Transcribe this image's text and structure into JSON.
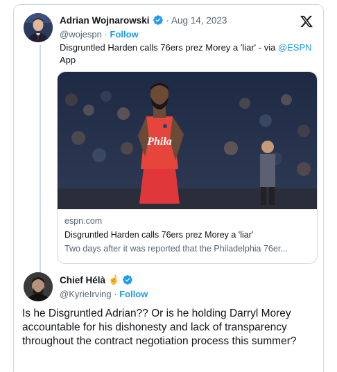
{
  "tweet1": {
    "display_name": "Adrian Wojnarowski",
    "date": "Aug 14, 2023",
    "handle": "@wojespn",
    "separator": "·",
    "follow_label": "Follow",
    "text_main": "Disgruntled Harden calls 76ers prez Morey a 'liar' - via ",
    "text_mention": "@ESPN",
    "text_tail": " App",
    "link_card": {
      "domain": "espn.com",
      "title": "Disgruntled Harden calls 76ers prez Morey a 'liar'",
      "description": "Two days after it was reported that the Philadelphia 76er..."
    }
  },
  "tweet2": {
    "display_name": "Chief Hélà",
    "handle": "@KyrieIrving",
    "separator": "·",
    "follow_label": "Follow",
    "text": "Is he Disgruntled Adrian?? Or is he holding Darryl Morey accountable for his dishonesty and lack of transparency throughout the contract negotiation process this summer?"
  },
  "image_jersey_text": "Phila",
  "colors": {
    "link_blue": "#1d9bf0",
    "secondary_text": "#536471",
    "border": "#cfd9de",
    "verified_blue": "#1d9bf0"
  },
  "icons": {
    "platform_logo": "x-logo-icon",
    "verified": "verified-badge-icon"
  }
}
